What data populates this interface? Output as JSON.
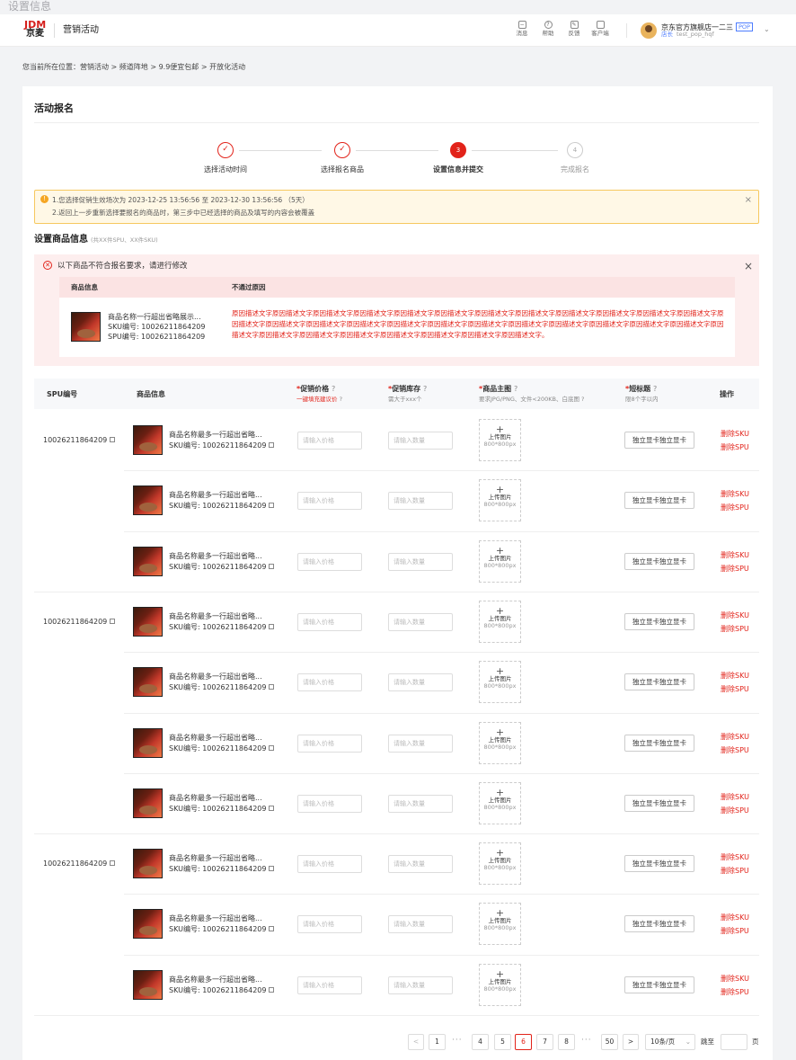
{
  "note": "设置信息",
  "header": {
    "logo_top": "JDM",
    "logo_bottom": "京麦",
    "title": "营销活动",
    "tools": [
      "消息",
      "帮助",
      "反馈",
      "客户端"
    ],
    "shop_name": "京东官方旗舰店一二三",
    "shop_badge": "POP",
    "role": "店长",
    "account": "test_pop_hqf"
  },
  "breadcrumb": "您当前所在位置：营销活动 > 频道阵地 > 9.9便宜包邮 > 开放化活动",
  "section_title": "活动报名",
  "steps": [
    {
      "label": "选择活动时间",
      "state": "done",
      "num": "1"
    },
    {
      "label": "选择报名商品",
      "state": "done",
      "num": "2"
    },
    {
      "label": "设置信息并提交",
      "state": "current",
      "num": "3"
    },
    {
      "label": "完成报名",
      "state": "todo",
      "num": "4"
    }
  ],
  "alert": {
    "line1": "1.您选择促销生效场次为 2023-12-25 13:56:56 至 2023-12-30 13:56:56 （5天）",
    "line2": "2.返回上一步重新选择要报名的商品时，第三步中已经选择的商品及填写的内容会被覆盖",
    "close": "×"
  },
  "product_section": {
    "title": "设置商品信息",
    "count": "(共XX件SPU、XX件SKU)"
  },
  "error_box": {
    "title": "以下商品不符合报名要求，请进行修改",
    "close": "×",
    "col_product": "商品信息",
    "col_reason": "不通过原因",
    "product_name": "商品名称一行超出省略展示...",
    "sku": "SKU编号: 10026211864209",
    "spu": "SPU编号: 10026211864209",
    "reason": "原因描述文字原因描述文字原因描述文字原因描述文字原因描述文字原因描述文字原因描述文字原因描述文字原因描述文字原因描述文字原因描述文字原因描述文字原因描述文字原因描述文字原因描述文字原因描述文字原因描述文字原因描述文字原因描述文字原因描述文字原因描述文字原因描述文字原因描述文字原因描述文字原因描述文字原因描述文字原因描述文字原因描述文字原因描述文字原因描述文字原因描述文字原因描述文字。"
  },
  "table": {
    "headers": {
      "spu": "SPU编号",
      "product": "商品信息",
      "price": "促销价格",
      "price_sub": "一键填充建议价",
      "stock": "促销库存",
      "stock_sub": "需大于xxx个",
      "image": "商品主图",
      "image_sub": "要求JPG/PNG、文件<200KB、白底图",
      "short_title": "短标题",
      "short_title_sub": "限8个字以内",
      "ops": "操作"
    },
    "required_mark": "*",
    "help_mark": "?",
    "spu_values": [
      "10026211864209",
      "10026211864209",
      "10026211864209"
    ],
    "rows": [
      {
        "name": "商品名称最多一行超出省略...",
        "sku": "SKU编号: 10026211864209"
      },
      {
        "name": "商品名称最多一行超出省略...",
        "sku": "SKU编号: 10026211864209"
      },
      {
        "name": "商品名称最多一行超出省略...",
        "sku": "SKU编号: 10026211864209"
      },
      {
        "name": "商品名称最多一行超出省略...",
        "sku": "SKU编号: 10026211864209"
      },
      {
        "name": "商品名称最多一行超出省略...",
        "sku": "SKU编号: 10026211864209"
      },
      {
        "name": "商品名称最多一行超出省略...",
        "sku": "SKU编号: 10026211864209"
      },
      {
        "name": "商品名称最多一行超出省略...",
        "sku": "SKU编号: 10026211864209"
      },
      {
        "name": "商品名称最多一行超出省略...",
        "sku": "SKU编号: 10026211864209"
      },
      {
        "name": "商品名称最多一行超出省略...",
        "sku": "SKU编号: 10026211864209"
      },
      {
        "name": "商品名称最多一行超出省略...",
        "sku": "SKU编号: 10026211864209"
      }
    ],
    "price_placeholder": "请输入价格",
    "stock_placeholder": "请输入数量",
    "upload_plus": "+",
    "upload_label": "上传图片",
    "upload_size": "800*800px",
    "short_title_value": "独立显卡独立显卡",
    "op_delete_sku": "删除SKU",
    "op_delete_spu": "删除SPU"
  },
  "pagination": {
    "prev": "<",
    "next": ">",
    "pages": [
      "1",
      "4",
      "5",
      "6",
      "7",
      "8",
      "50"
    ],
    "current": "6",
    "ellipsis": "···",
    "page_size": "10条/页",
    "jump_label": "跳至",
    "jump_unit": "页"
  },
  "colors": {
    "accent": "#e2231a",
    "alert_bg": "#fff8e6",
    "error_bg": "#fdeeee",
    "link": "#4d7cfe"
  }
}
